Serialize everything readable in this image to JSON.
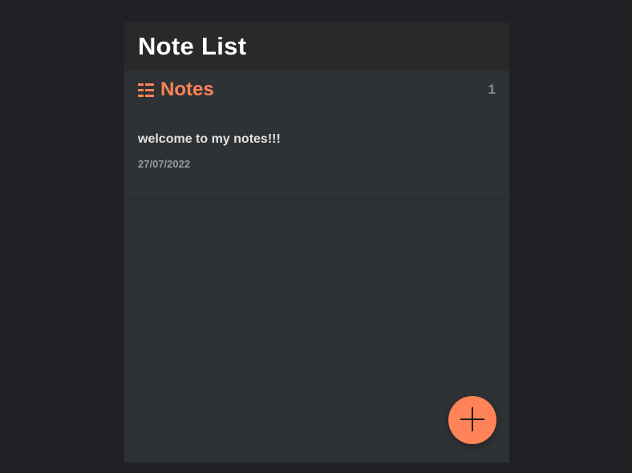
{
  "header": {
    "title": "Note List"
  },
  "section": {
    "title": "Notes",
    "icon": "list-icon",
    "count": "1"
  },
  "notes": [
    {
      "title": "welcome to my notes!!!",
      "date": "27/07/2022"
    }
  ],
  "fab": {
    "icon": "plus-icon"
  },
  "colors": {
    "background": "#202124",
    "panel": "#2f3235",
    "header": "#28292b",
    "accent": "#ff8356"
  }
}
